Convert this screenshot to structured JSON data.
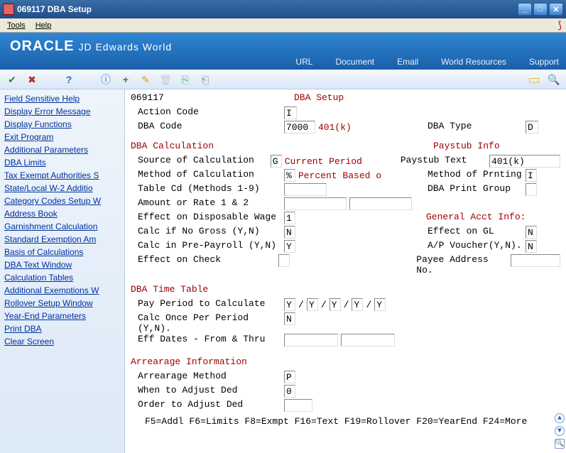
{
  "window": {
    "title": "069117    DBA Setup"
  },
  "menubar": {
    "tools": "Tools",
    "help": "Help"
  },
  "banner": {
    "brand_main": "ORACLE",
    "brand_sub": "JD Edwards World",
    "links": {
      "url": "URL",
      "document": "Document",
      "email": "Email",
      "resources": "World Resources",
      "support": "Support"
    }
  },
  "sidebar": {
    "items": [
      "Field Sensitive Help",
      "Display Error Message",
      "Display Functions",
      "Exit Program",
      "Additional Parameters",
      "DBA Limits",
      "Tax Exempt Authorities S",
      "State/Local W-2 Additio",
      "Category Codes Setup W",
      "Address Book",
      "Garnishment Calculation",
      "Standard Exemption Am",
      "Basis of Calculations",
      "DBA Text Window",
      "Calculation Tables",
      "Additional Exemptions W",
      "Rollover Setup Window",
      "Year-End Parameters",
      "Print DBA",
      "Clear Screen"
    ]
  },
  "form": {
    "code_disp": "069117",
    "title": "DBA Setup",
    "action_code_lbl": "Action Code",
    "action_code": "I",
    "dba_code_lbl": "DBA Code",
    "dba_code": "7000",
    "dba_code_desc": "401(k)",
    "dba_type_lbl": "DBA Type",
    "dba_type": "D",
    "calc_hdr": "DBA Calculation",
    "paystub_hdr": "Paystub Info",
    "src_calc_lbl": "Source of Calculation",
    "src_calc": "G",
    "src_calc_desc": "Current Period",
    "paystub_text_lbl": "Paystub Text",
    "paystub_text": "401(k)",
    "method_calc_lbl": "Method of Calculation",
    "method_calc": "%",
    "method_calc_desc": "Percent Based o",
    "method_prnt_lbl": "Method of Prnting",
    "method_prnt": "I",
    "table_cd_lbl": "Table Cd (Methods 1-9)",
    "table_cd": "",
    "dba_print_grp_lbl": "DBA Print Group",
    "dba_print_grp": "",
    "amount_rate_lbl": "Amount or Rate 1 & 2",
    "amount_rate1": "",
    "amount_rate2": "",
    "eff_disp_lbl": "Effect on Disposable Wage",
    "eff_disp": "1",
    "gen_acct_hdr": "General Acct Info:",
    "calc_no_gross_lbl": "Calc if No Gross (Y,N)",
    "calc_no_gross": "N",
    "effect_gl_lbl": "Effect on GL",
    "effect_gl": "N",
    "calc_pre_lbl": "Calc in Pre-Payroll (Y,N)",
    "calc_pre": "Y",
    "ap_voucher_lbl": "A/P Voucher(Y,N).",
    "ap_voucher": "N",
    "eff_check_lbl": "Effect on Check",
    "eff_check": "",
    "payee_addr_lbl": "Payee Address No.",
    "payee_addr": "",
    "time_hdr": "DBA Time Table",
    "pay_period_lbl": "Pay Period to Calculate",
    "pay_period": [
      "Y",
      "Y",
      "Y",
      "Y",
      "Y"
    ],
    "calc_once_lbl": "Calc Once Per Period (Y,N).",
    "calc_once": "N",
    "eff_dates_lbl": "Eff Dates - From & Thru",
    "eff_from": "",
    "eff_thru": "",
    "arr_hdr": "Arrearage Information",
    "arr_method_lbl": "Arrearage Method",
    "arr_method": "P",
    "when_adj_lbl": "When to Adjust Ded",
    "when_adj": "0",
    "order_adj_lbl": "Order to Adjust Ded",
    "order_adj": "",
    "fkeys": "  F5=Addl  F6=Limits  F8=Exmpt  F16=Text  F19=Rollover  F20=YearEnd  F24=More"
  }
}
